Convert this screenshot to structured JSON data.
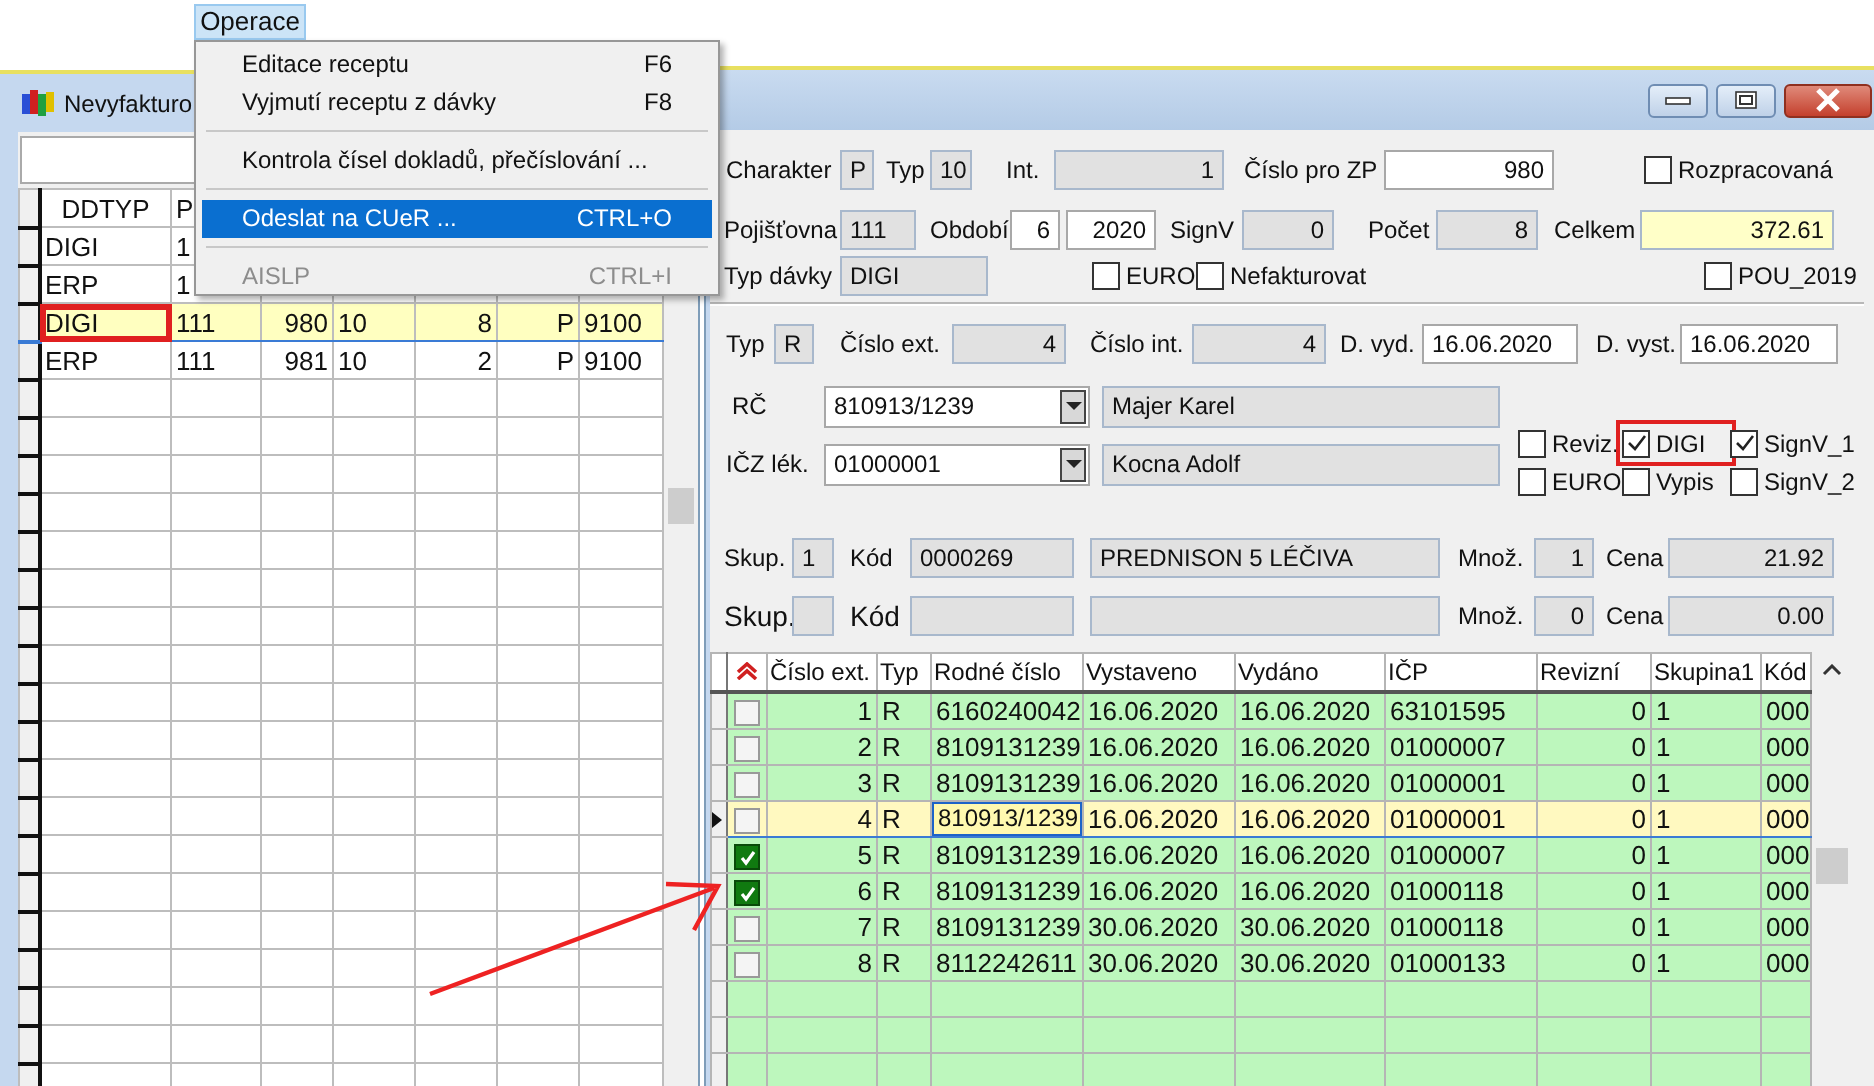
{
  "menu": {
    "title": "Operace",
    "items": [
      {
        "kind": "item",
        "label": "Editace receptu",
        "shortcut": "F6",
        "selected": false,
        "disabled": false
      },
      {
        "kind": "item",
        "label": "Vyjmutí receptu z dávky",
        "shortcut": "F8",
        "selected": false,
        "disabled": false
      },
      {
        "kind": "separator"
      },
      {
        "kind": "item",
        "label": "Kontrola čísel dokladů, přečíslování ...",
        "selected": false,
        "disabled": false
      },
      {
        "kind": "separator"
      },
      {
        "kind": "item",
        "label": "Odeslat na CUeR ...",
        "shortcut": "CTRL+O",
        "selected": true,
        "disabled": false
      },
      {
        "kind": "separator"
      },
      {
        "kind": "item",
        "label": "AISLP",
        "shortcut": "CTRL+I",
        "selected": false,
        "disabled": true
      }
    ]
  },
  "list_window": {
    "title": "Nevyfakturo",
    "columns": [
      "DDTYP",
      "P"
    ],
    "rows": [
      {
        "cells": [
          "DIGI",
          "1"
        ],
        "selected": false,
        "annotated": false
      },
      {
        "cells": [
          "ERP",
          "1"
        ],
        "selected": false,
        "annotated": false
      },
      {
        "cells": [
          "DIGI",
          "111",
          "980",
          "10",
          "8",
          "P",
          "9100"
        ],
        "selected": true,
        "annotated": true
      },
      {
        "cells": [
          "ERP",
          "111",
          "981",
          "10",
          "2",
          "P",
          "9100"
        ],
        "selected": false,
        "annotated": false
      }
    ]
  },
  "detail_window": {
    "form_rows": [
      [
        {
          "kind": "label",
          "value": "Charakter"
        },
        {
          "kind": "field",
          "value": "P"
        },
        {
          "kind": "label",
          "value": "Typ"
        },
        {
          "kind": "field",
          "value": "10"
        },
        {
          "kind": "label",
          "value": "Int."
        },
        {
          "kind": "field",
          "value": "1"
        },
        {
          "kind": "label",
          "value": "Číslo pro ZP"
        },
        {
          "kind": "input",
          "value": "980"
        },
        {
          "kind": "check",
          "label": "Rozpracovaná",
          "checked": false
        }
      ],
      [
        {
          "kind": "label",
          "value": "Pojišťovna"
        },
        {
          "kind": "field",
          "value": "111"
        },
        {
          "kind": "label",
          "value": "Období"
        },
        {
          "kind": "input",
          "value": "6"
        },
        {
          "kind": "input",
          "value": "2020"
        },
        {
          "kind": "label",
          "value": "SignV"
        },
        {
          "kind": "field",
          "value": "0"
        },
        {
          "kind": "label",
          "value": "Počet"
        },
        {
          "kind": "field",
          "value": "8"
        },
        {
          "kind": "label",
          "value": "Celkem"
        },
        {
          "kind": "total",
          "value": "372.61"
        }
      ],
      [
        {
          "kind": "label",
          "value": "Typ dávky"
        },
        {
          "kind": "field",
          "value": "DIGI"
        },
        {
          "kind": "check",
          "label": "EURO",
          "checked": false
        },
        {
          "kind": "check",
          "label": "Nefakturovat",
          "checked": false
        },
        {
          "kind": "check",
          "label": "POU_2019",
          "checked": false
        }
      ],
      [
        {
          "kind": "label",
          "value": "Typ"
        },
        {
          "kind": "field",
          "value": "R"
        },
        {
          "kind": "label",
          "value": "Číslo ext."
        },
        {
          "kind": "field",
          "value": "4"
        },
        {
          "kind": "label",
          "value": "Číslo int."
        },
        {
          "kind": "field",
          "value": "4"
        },
        {
          "kind": "label",
          "value": "D. vyd."
        },
        {
          "kind": "input",
          "value": "16.06.2020"
        },
        {
          "kind": "label",
          "value": "D. vyst."
        },
        {
          "kind": "input",
          "value": "16.06.2020"
        }
      ],
      [
        {
          "kind": "label",
          "value": "RČ"
        },
        {
          "kind": "combo",
          "value": "810913/1239"
        },
        {
          "kind": "field",
          "value": "Majer Karel"
        }
      ],
      [
        {
          "kind": "label",
          "value": "IČZ lék."
        },
        {
          "kind": "combo",
          "value": "01000001"
        },
        {
          "kind": "field",
          "value": "Kocna Adolf"
        }
      ],
      [
        {
          "kind": "label",
          "value": "Skup."
        },
        {
          "kind": "field",
          "value": "1"
        },
        {
          "kind": "label",
          "value": "Kód"
        },
        {
          "kind": "field",
          "value": "0000269"
        },
        {
          "kind": "field",
          "value": "PREDNISON 5 LÉČIVA"
        },
        {
          "kind": "label",
          "value": "Množ."
        },
        {
          "kind": "field",
          "value": "1"
        },
        {
          "kind": "label",
          "value": "Cena"
        },
        {
          "kind": "field",
          "value": "21.92"
        }
      ],
      [
        {
          "kind": "label",
          "value": "Skup."
        },
        {
          "kind": "field"
        },
        {
          "kind": "label",
          "value": "Kód"
        },
        {
          "kind": "field"
        },
        {
          "kind": "field"
        },
        {
          "kind": "label",
          "value": "Množ."
        },
        {
          "kind": "field",
          "value": "0"
        },
        {
          "kind": "label",
          "value": "Cena"
        },
        {
          "kind": "field",
          "value": "0.00"
        }
      ]
    ],
    "flags": [
      {
        "label": "Reviz.",
        "checked": false,
        "annotated": false
      },
      {
        "label": "DIGI",
        "checked": true,
        "annotated": true
      },
      {
        "label": "SignV_1",
        "checked": true,
        "annotated": false
      },
      {
        "label": "EURO",
        "checked": false,
        "annotated": false
      },
      {
        "label": "Vypis",
        "checked": false,
        "annotated": false
      },
      {
        "label": "SignV_2",
        "checked": false,
        "annotated": false
      }
    ],
    "table": {
      "columns": [
        "Číslo ext.",
        "Typ",
        "Rodné číslo",
        "Vystaveno",
        "Vydáno",
        "IČP",
        "Revizní",
        "Skupina1",
        "Kód"
      ],
      "rows": [
        {
          "checked": false,
          "current": false,
          "cells": [
            "1",
            "R",
            "6160240042",
            "16.06.2020",
            "16.06.2020",
            "63101595",
            "0",
            "1",
            "000"
          ]
        },
        {
          "checked": false,
          "current": false,
          "cells": [
            "2",
            "R",
            "8109131239",
            "16.06.2020",
            "16.06.2020",
            "01000007",
            "0",
            "1",
            "000"
          ]
        },
        {
          "checked": false,
          "current": false,
          "cells": [
            "3",
            "R",
            "8109131239",
            "16.06.2020",
            "16.06.2020",
            "01000001",
            "0",
            "1",
            "000"
          ]
        },
        {
          "checked": false,
          "current": true,
          "cells": [
            "4",
            "R",
            "810913/1239",
            "16.06.2020",
            "16.06.2020",
            "01000001",
            "0",
            "1",
            "000"
          ]
        },
        {
          "checked": true,
          "current": false,
          "cells": [
            "5",
            "R",
            "8109131239",
            "16.06.2020",
            "16.06.2020",
            "01000007",
            "0",
            "1",
            "000"
          ]
        },
        {
          "checked": true,
          "current": false,
          "cells": [
            "6",
            "R",
            "8109131239",
            "16.06.2020",
            "16.06.2020",
            "01000118",
            "0",
            "1",
            "000"
          ]
        },
        {
          "checked": false,
          "current": false,
          "cells": [
            "7",
            "R",
            "8109131239",
            "30.06.2020",
            "30.06.2020",
            "01000118",
            "0",
            "1",
            "000"
          ]
        },
        {
          "checked": false,
          "current": false,
          "cells": [
            "8",
            "R",
            "8112242611",
            "30.06.2020",
            "30.06.2020",
            "01000133",
            "0",
            "1",
            "000"
          ]
        }
      ]
    }
  }
}
